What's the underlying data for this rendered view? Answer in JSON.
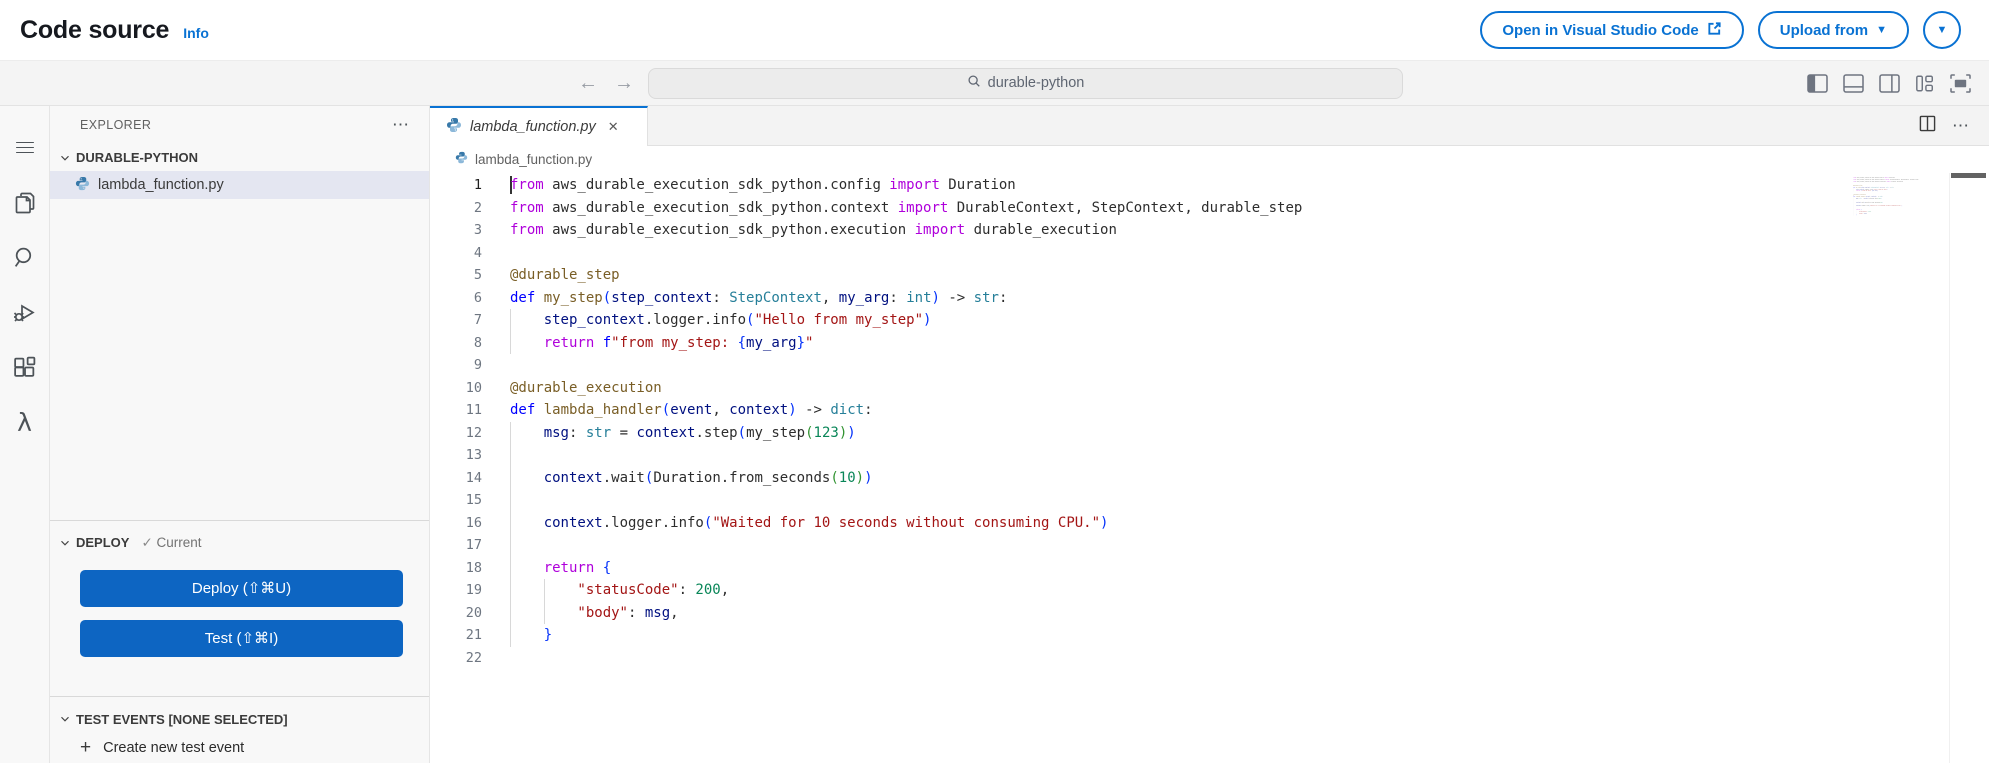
{
  "header": {
    "title": "Code source",
    "info_link": "Info",
    "open_vscode_label": "Open in Visual Studio Code",
    "upload_from_label": "Upload from"
  },
  "titlebar": {
    "search_value": "durable-python"
  },
  "icons": {
    "back": "←",
    "forward": "→",
    "more": "⋯",
    "close": "✕",
    "caret_down": "▼",
    "check": "✓",
    "plus": "+",
    "lambda": "λ"
  },
  "activity_bar": [
    "menu",
    "explorer",
    "search",
    "run-debug",
    "extensions",
    "aws-lambda"
  ],
  "sidebar": {
    "explorer_label": "EXPLORER",
    "folder_label": "DURABLE-PYTHON",
    "file_label": "lambda_function.py",
    "deploy": {
      "label": "DEPLOY",
      "status": "Current",
      "deploy_button": "Deploy (⇧⌘U)",
      "test_button": "Test (⇧⌘I)"
    },
    "test_events": {
      "label": "TEST EVENTS [NONE SELECTED]",
      "create_label": "Create new test event"
    }
  },
  "editor": {
    "tab_label": "lambda_function.py",
    "breadcrumb": "lambda_function.py",
    "syntax_colors": {
      "keyword_control": "#af00db",
      "keyword_def": "#0000ff",
      "type": "#267f99",
      "function": "#795e26",
      "variable": "#001080",
      "string": "#a31515",
      "number": "#098658",
      "bracket1": "#0431fa",
      "bracket2": "#319331",
      "default": "#2d2d2d"
    },
    "code_lines": [
      {
        "n": 1,
        "active": true,
        "cursor": true,
        "guides": 0,
        "tokens": [
          [
            "k1",
            "from"
          ],
          [
            "df",
            " aws_durable_execution_sdk_python.config "
          ],
          [
            "k1",
            "import"
          ],
          [
            "df",
            " Duration"
          ]
        ]
      },
      {
        "n": 2,
        "guides": 0,
        "tokens": [
          [
            "k1",
            "from"
          ],
          [
            "df",
            " aws_durable_execution_sdk_python.context "
          ],
          [
            "k1",
            "import"
          ],
          [
            "df",
            " DurableContext, StepContext, durable_step"
          ]
        ]
      },
      {
        "n": 3,
        "guides": 0,
        "tokens": [
          [
            "k1",
            "from"
          ],
          [
            "df",
            " aws_durable_execution_sdk_python.execution "
          ],
          [
            "k1",
            "import"
          ],
          [
            "df",
            " durable_execution"
          ]
        ]
      },
      {
        "n": 4,
        "guides": 0,
        "tokens": []
      },
      {
        "n": 5,
        "guides": 0,
        "tokens": [
          [
            "fn",
            "@durable_step"
          ]
        ]
      },
      {
        "n": 6,
        "guides": 0,
        "tokens": [
          [
            "k2",
            "def"
          ],
          [
            "df",
            " "
          ],
          [
            "fn",
            "my_step"
          ],
          [
            "p1",
            "("
          ],
          [
            "va",
            "step_context"
          ],
          [
            "df",
            ": "
          ],
          [
            "ty",
            "StepContext"
          ],
          [
            "df",
            ", "
          ],
          [
            "va",
            "my_arg"
          ],
          [
            "df",
            ": "
          ],
          [
            "ty",
            "int"
          ],
          [
            "p1",
            ")"
          ],
          [
            "df",
            " -> "
          ],
          [
            "ty",
            "str"
          ],
          [
            "df",
            ":"
          ]
        ]
      },
      {
        "n": 7,
        "guides": 1,
        "tokens": [
          [
            "va",
            "step_context"
          ],
          [
            "df",
            ".logger.info"
          ],
          [
            "p1",
            "("
          ],
          [
            "st",
            "\"Hello from my_step\""
          ],
          [
            "p1",
            ")"
          ]
        ]
      },
      {
        "n": 8,
        "guides": 1,
        "tokens": [
          [
            "k1",
            "return"
          ],
          [
            "df",
            " "
          ],
          [
            "k2",
            "f"
          ],
          [
            "st",
            "\"from my_step: "
          ],
          [
            "p1",
            "{"
          ],
          [
            "va",
            "my_arg"
          ],
          [
            "p1",
            "}"
          ],
          [
            "st",
            "\""
          ]
        ]
      },
      {
        "n": 9,
        "guides": 0,
        "tokens": []
      },
      {
        "n": 10,
        "guides": 0,
        "tokens": [
          [
            "fn",
            "@durable_execution"
          ]
        ]
      },
      {
        "n": 11,
        "guides": 0,
        "tokens": [
          [
            "k2",
            "def"
          ],
          [
            "df",
            " "
          ],
          [
            "fn",
            "lambda_handler"
          ],
          [
            "p1",
            "("
          ],
          [
            "va",
            "event"
          ],
          [
            "df",
            ", "
          ],
          [
            "va",
            "context"
          ],
          [
            "p1",
            ")"
          ],
          [
            "df",
            " -> "
          ],
          [
            "ty",
            "dict"
          ],
          [
            "df",
            ":"
          ]
        ]
      },
      {
        "n": 12,
        "guides": 1,
        "tokens": [
          [
            "va",
            "msg"
          ],
          [
            "df",
            ": "
          ],
          [
            "ty",
            "str"
          ],
          [
            "df",
            " = "
          ],
          [
            "va",
            "context"
          ],
          [
            "df",
            ".step"
          ],
          [
            "p1",
            "("
          ],
          [
            "df",
            "my_step"
          ],
          [
            "p2",
            "("
          ],
          [
            "nu",
            "123"
          ],
          [
            "p2",
            ")"
          ],
          [
            "p1",
            ")"
          ]
        ]
      },
      {
        "n": 13,
        "guides": 1,
        "tokens": []
      },
      {
        "n": 14,
        "guides": 1,
        "tokens": [
          [
            "va",
            "context"
          ],
          [
            "df",
            ".wait"
          ],
          [
            "p1",
            "("
          ],
          [
            "df",
            "Duration.from_seconds"
          ],
          [
            "p2",
            "("
          ],
          [
            "nu",
            "10"
          ],
          [
            "p2",
            ")"
          ],
          [
            "p1",
            ")"
          ]
        ]
      },
      {
        "n": 15,
        "guides": 1,
        "tokens": []
      },
      {
        "n": 16,
        "guides": 1,
        "tokens": [
          [
            "va",
            "context"
          ],
          [
            "df",
            ".logger.info"
          ],
          [
            "p1",
            "("
          ],
          [
            "st",
            "\"Waited for 10 seconds without consuming CPU.\""
          ],
          [
            "p1",
            ")"
          ]
        ]
      },
      {
        "n": 17,
        "guides": 1,
        "tokens": []
      },
      {
        "n": 18,
        "guides": 1,
        "tokens": [
          [
            "k1",
            "return"
          ],
          [
            "df",
            " "
          ],
          [
            "p1",
            "{"
          ]
        ]
      },
      {
        "n": 19,
        "guides": 2,
        "tokens": [
          [
            "st",
            "\"statusCode\""
          ],
          [
            "df",
            ": "
          ],
          [
            "nu",
            "200"
          ],
          [
            "df",
            ","
          ]
        ]
      },
      {
        "n": 20,
        "guides": 2,
        "tokens": [
          [
            "st",
            "\"body\""
          ],
          [
            "df",
            ": "
          ],
          [
            "va",
            "msg"
          ],
          [
            "df",
            ","
          ]
        ]
      },
      {
        "n": 21,
        "guides": 1,
        "tokens": [
          [
            "p1",
            "}"
          ]
        ]
      },
      {
        "n": 22,
        "guides": 0,
        "tokens": []
      }
    ]
  },
  "colors": {
    "accent_blue": "#0972d3",
    "button_blue": "#0d65c2",
    "selected_file_bg": "#e4e6f1",
    "titlebar_bg": "#f4f4f4",
    "sidebar_bg": "#f8f8f8"
  }
}
